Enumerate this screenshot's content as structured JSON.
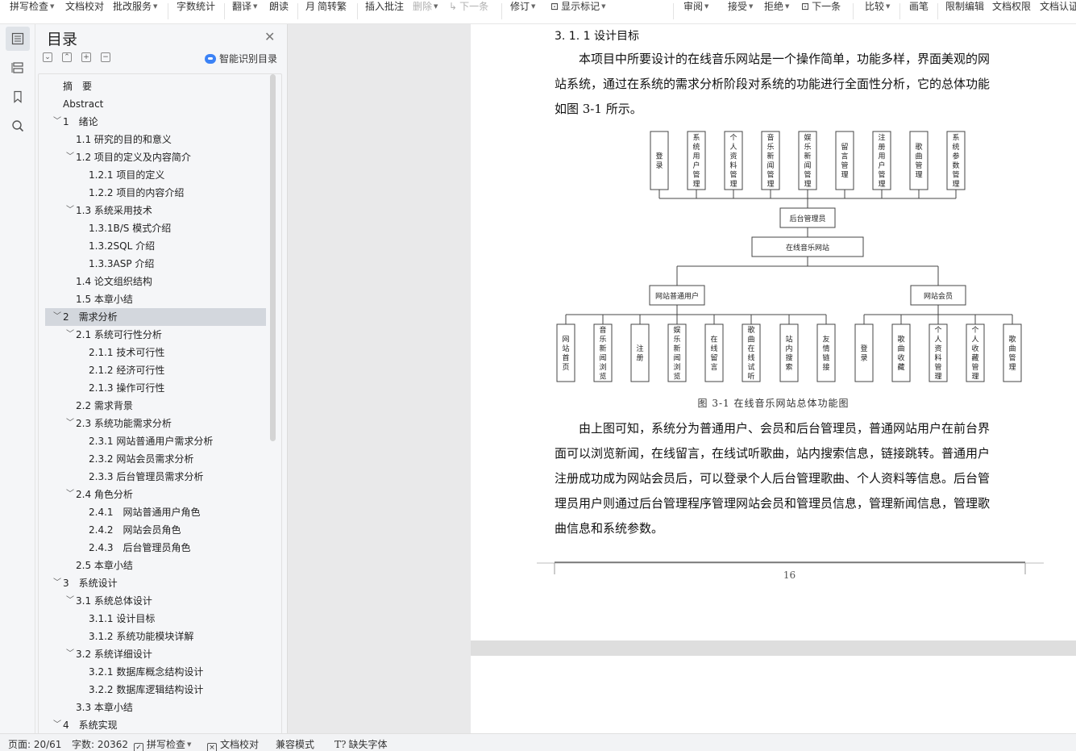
{
  "toolbar": {
    "items": [
      {
        "label": "拼写检查",
        "dropdown": true
      },
      {
        "label": "文档校对",
        "dropdown": false
      },
      {
        "label": "批改服务",
        "dropdown": true
      },
      {
        "label": "字数统计",
        "dropdown": false
      },
      {
        "label": "翻译",
        "dropdown": true
      },
      {
        "label": "朗读",
        "dropdown": false
      },
      {
        "label": "简转繁",
        "dropdown": false
      },
      {
        "label": "插入批注",
        "dropdown": false
      },
      {
        "label": "删除",
        "dropdown": true,
        "disabled": true
      },
      {
        "label": "下一条",
        "dropdown": false,
        "disabled": true
      },
      {
        "label": "修订",
        "dropdown": true
      },
      {
        "label": "显示标记",
        "dropdown": true
      },
      {
        "label": "审阅",
        "dropdown": true
      },
      {
        "label": "接受",
        "dropdown": true
      },
      {
        "label": "拒绝",
        "dropdown": true
      },
      {
        "label": "下一条",
        "dropdown": false
      },
      {
        "label": "比较",
        "dropdown": true
      },
      {
        "label": "画笔",
        "dropdown": false
      },
      {
        "label": "限制编辑",
        "dropdown": false
      },
      {
        "label": "文档权限",
        "dropdown": false
      },
      {
        "label": "文档认证",
        "dropdown": false
      }
    ]
  },
  "sidebar": {
    "title": "目录",
    "smart_label": "智能识别目录",
    "toc": [
      {
        "label": "摘　要",
        "level": 1,
        "chevron": false
      },
      {
        "label": "Abstract",
        "level": 1,
        "chevron": false
      },
      {
        "label": "1　绪论",
        "level": 1,
        "chevron": true
      },
      {
        "label": "1.1 研究的目的和意义",
        "level": 2,
        "chevron": false
      },
      {
        "label": "1.2 项目的定义及内容简介",
        "level": 2,
        "chevron": true
      },
      {
        "label": "1.2.1 项目的定义",
        "level": 3,
        "chevron": false
      },
      {
        "label": "1.2.2 项目的内容介绍",
        "level": 3,
        "chevron": false
      },
      {
        "label": "1.3 系统采用技术",
        "level": 2,
        "chevron": true
      },
      {
        "label": "1.3.1B/S 模式介绍",
        "level": 3,
        "chevron": false
      },
      {
        "label": "1.3.2SQL 介绍",
        "level": 3,
        "chevron": false
      },
      {
        "label": "1.3.3ASP 介绍",
        "level": 3,
        "chevron": false
      },
      {
        "label": "1.4 论文组织结构",
        "level": 2,
        "chevron": false
      },
      {
        "label": "1.5 本章小结",
        "level": 2,
        "chevron": false
      },
      {
        "label": "2　需求分析",
        "level": 1,
        "chevron": true,
        "selected": true
      },
      {
        "label": "2.1 系统可行性分析",
        "level": 2,
        "chevron": true
      },
      {
        "label": "2.1.1 技术可行性",
        "level": 3,
        "chevron": false
      },
      {
        "label": "2.1.2 经济可行性",
        "level": 3,
        "chevron": false
      },
      {
        "label": "2.1.3 操作可行性",
        "level": 3,
        "chevron": false
      },
      {
        "label": "2.2 需求背景",
        "level": 2,
        "chevron": false
      },
      {
        "label": "2.3 系统功能需求分析",
        "level": 2,
        "chevron": true
      },
      {
        "label": "2.3.1 网站普通用户需求分析",
        "level": 3,
        "chevron": false
      },
      {
        "label": "2.3.2 网站会员需求分析",
        "level": 3,
        "chevron": false
      },
      {
        "label": "2.3.3 后台管理员需求分析",
        "level": 3,
        "chevron": false
      },
      {
        "label": "2.4 角色分析",
        "level": 2,
        "chevron": true
      },
      {
        "label": "2.4.1　网站普通用户角色",
        "level": 3,
        "chevron": false
      },
      {
        "label": "2.4.2　网站会员角色",
        "level": 3,
        "chevron": false
      },
      {
        "label": "2.4.3　后台管理员角色",
        "level": 3,
        "chevron": false
      },
      {
        "label": "2.5 本章小结",
        "level": 2,
        "chevron": false
      },
      {
        "label": "3　系统设计",
        "level": 1,
        "chevron": true
      },
      {
        "label": "3.1 系统总体设计",
        "level": 2,
        "chevron": true
      },
      {
        "label": "3.1.1 设计目标",
        "level": 3,
        "chevron": false
      },
      {
        "label": "3.1.2 系统功能模块详解",
        "level": 3,
        "chevron": false
      },
      {
        "label": "3.2 系统详细设计",
        "level": 2,
        "chevron": true
      },
      {
        "label": "3.2.1 数据库概念结构设计",
        "level": 3,
        "chevron": false
      },
      {
        "label": "3.2.2 数据库逻辑结构设计",
        "level": 3,
        "chevron": false
      },
      {
        "label": "3.3 本章小结",
        "level": 2,
        "chevron": false
      },
      {
        "label": "4　系统实现",
        "level": 1,
        "chevron": true
      }
    ]
  },
  "document": {
    "section_heading": "3. 1. 1 设计目标",
    "para1": [
      "　　本项目中所要设计的在线音乐网站是一个操作简单，功能多样，界面美观的网",
      "站系统，通过在系统的需求分析阶段对系统的功能进行全面性分析，它的总体功能",
      "如图 3-1 所示。"
    ],
    "caption": "图 3-1 在线音乐网站总体功能图",
    "para2": [
      "　　由上图可知，系统分为普通用户、会员和后台管理员，普通网站用户在前台界",
      "面可以浏览新闻，在线留言，在线试听歌曲，站内搜索信息，链接跳转。普通用户",
      "注册成功成为网站会员后，可以登录个人后台管理歌曲、个人资料等信息。后台管",
      "理员用户则通过后台管理程序管理网站会员和管理员信息，管理新闻信息，管理歌",
      "曲信息和系统参数。"
    ],
    "page_number": "16",
    "diagram": {
      "root": "在线音乐网站",
      "admin": "后台管理员",
      "admin_modules": [
        "登录",
        "系统用户管理",
        "个人资料管理",
        "音乐新闻管理",
        "娱乐新闻管理",
        "留言管理",
        "注册用户管理",
        "歌曲管理",
        "系统参数管理"
      ],
      "user": "网站普通用户",
      "user_modules": [
        "网站首页",
        "音乐新闻浏览",
        "注册",
        "娱乐新闻浏览",
        "在线留言",
        "歌曲在线试听",
        "站内搜索",
        "友情链接"
      ],
      "member": "网站会员",
      "member_modules": [
        "登录",
        "歌曲收藏",
        "个人资料管理",
        "个人收藏管理",
        "歌曲管理"
      ]
    }
  },
  "statusbar": {
    "page": "页面: 20/61",
    "words": "字数: 20362",
    "spell": "拼写检查",
    "proof": "文档校对",
    "compat": "兼容模式",
    "missing_font": "缺失字体"
  }
}
